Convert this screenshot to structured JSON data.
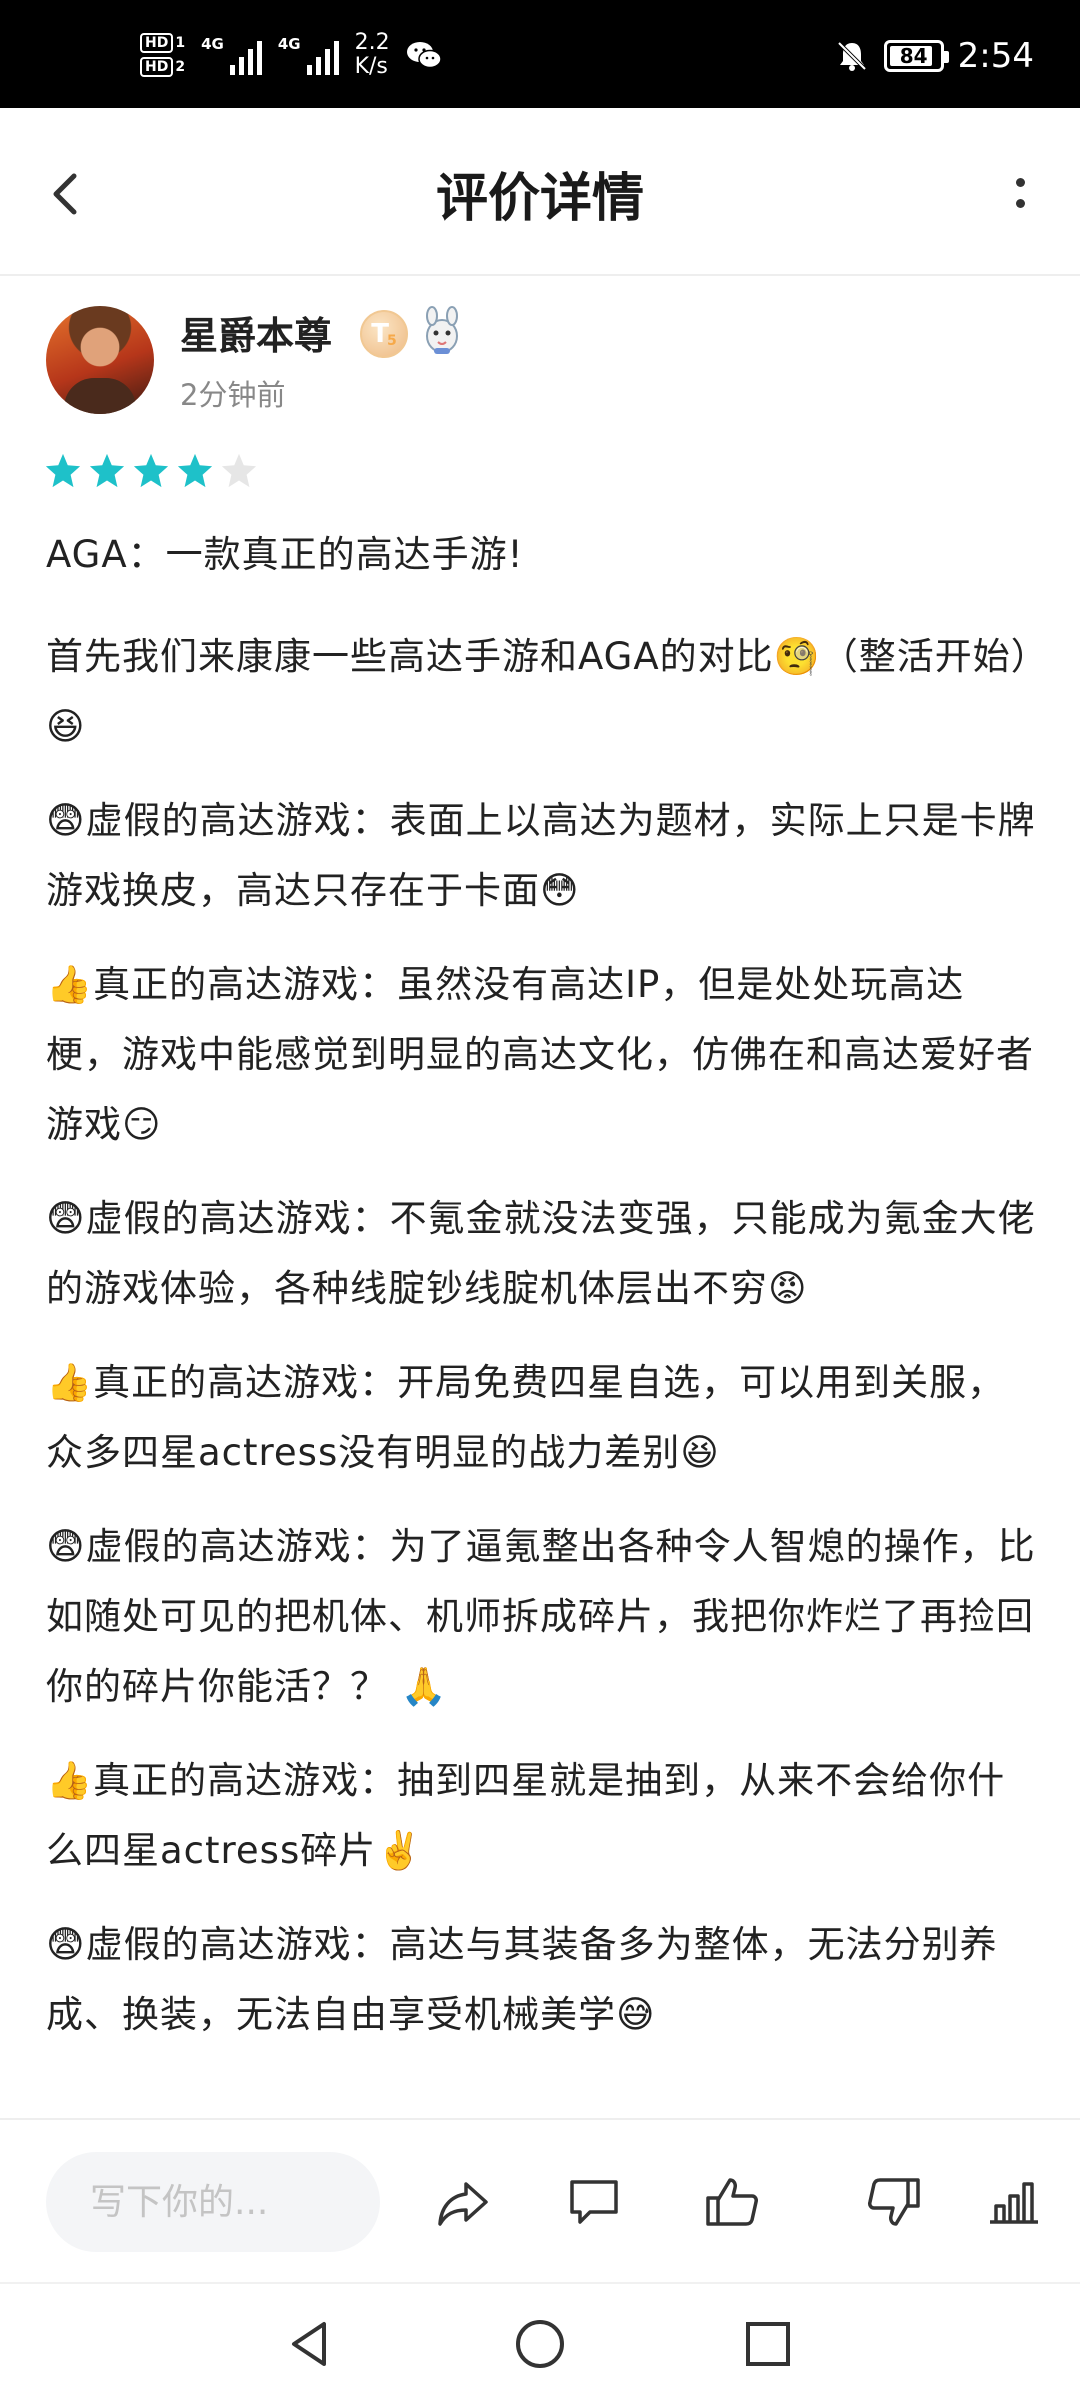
{
  "status_bar": {
    "sim1": "HD",
    "sim1_num": "1",
    "sim2": "HD",
    "sim2_num": "2",
    "net1": "4G",
    "net2": "4G",
    "speed_value": "2.2",
    "speed_unit": "K/s",
    "battery": "84",
    "time": "2:54"
  },
  "header": {
    "title": "评价详情"
  },
  "review": {
    "author": "星爵本尊",
    "level_badge": "T",
    "level_num": "5",
    "time": "2分钟前",
    "rating": 4,
    "rating_max": 5,
    "paragraphs": [
      "AGA：一款真正的高达手游!",
      "首先我们来康康一些高达手游和AGA的对比🧐（整活开始）😆",
      "😨虚假的高达游戏：表面上以高达为题材，实际上只是卡牌游戏换皮，高达只存在于卡面😳",
      "👍真正的高达游戏：虽然没有高达IP，但是处处玩高达梗，游戏中能感觉到明显的高达文化，仿佛在和高达爱好者游戏😏",
      "😨虚假的高达游戏：不氪金就没法变强，只能成为氪金大佬的游戏体验，各种线腚钞线腚机体层出不穷😡",
      "👍真正的高达游戏：开局免费四星自选，可以用到关服，众多四星actress没有明显的战力差别😆",
      "😨虚假的高达游戏：为了逼氪整出各种令人智熄的操作，比如随处可见的把机体、机师拆成碎片，我把你炸烂了再捡回你的碎片你能活？？ 🙏",
      "👍真正的高达游戏：抽到四星就是抽到，从来不会给你什么四星actress碎片✌️",
      "😨虚假的高达游戏：高达与其装备多为整体，无法分别养成、换装，无法自由享受机械美学😅"
    ]
  },
  "actions": {
    "comment_placeholder": "写下你的..."
  },
  "colors": {
    "star_filled": "#1ec1c9",
    "star_empty": "#e6e6e6"
  }
}
